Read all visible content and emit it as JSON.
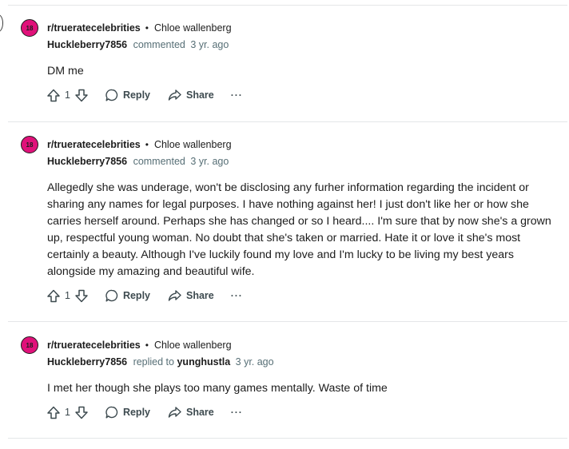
{
  "comments": [
    {
      "badge": "18",
      "subreddit": "r/trueratecelebrities",
      "separator": "•",
      "post_author": "Chloe wallenberg",
      "author": "Huckleberry7856",
      "action": "commented",
      "reply_target": "",
      "time": "3 yr. ago",
      "body": "DM me",
      "votes": "1",
      "reply_label": "Reply",
      "share_label": "Share",
      "more_label": "···"
    },
    {
      "badge": "18",
      "subreddit": "r/trueratecelebrities",
      "separator": "•",
      "post_author": "Chloe wallenberg",
      "author": "Huckleberry7856",
      "action": "commented",
      "reply_target": "",
      "time": "3 yr. ago",
      "body": "Allegedly she was underage, won't be disclosing any furher information regarding the incident or sharing any names for legal purposes. I have nothing against her! I just don't like her or how she carries herself around. Perhaps she has changed or so I heard.... I'm sure that by now she's a grown up, respectful young woman. No doubt that she's taken or married. Hate it or love it she's most certainly a beauty. Although I've luckily found my love and I'm lucky to be living my best years alongside my amazing and beautiful wife.",
      "votes": "1",
      "reply_label": "Reply",
      "share_label": "Share",
      "more_label": "···"
    },
    {
      "badge": "18",
      "subreddit": "r/trueratecelebrities",
      "separator": "•",
      "post_author": "Chloe wallenberg",
      "author": "Huckleberry7856",
      "action": "replied to",
      "reply_target": "yunghustla",
      "time": "3 yr. ago",
      "body": "I met her though she plays too many games mentally. Waste of time",
      "votes": "1",
      "reply_label": "Reply",
      "share_label": "Share",
      "more_label": "···"
    }
  ],
  "colors": {
    "nsfw_badge": "#e0117a",
    "meta_gray": "#576f76",
    "divider": "#e4e6e8"
  },
  "icons": [
    "upvote-icon",
    "downvote-icon",
    "comment-bubble-icon",
    "share-arrow-icon",
    "more-options-icon"
  ]
}
